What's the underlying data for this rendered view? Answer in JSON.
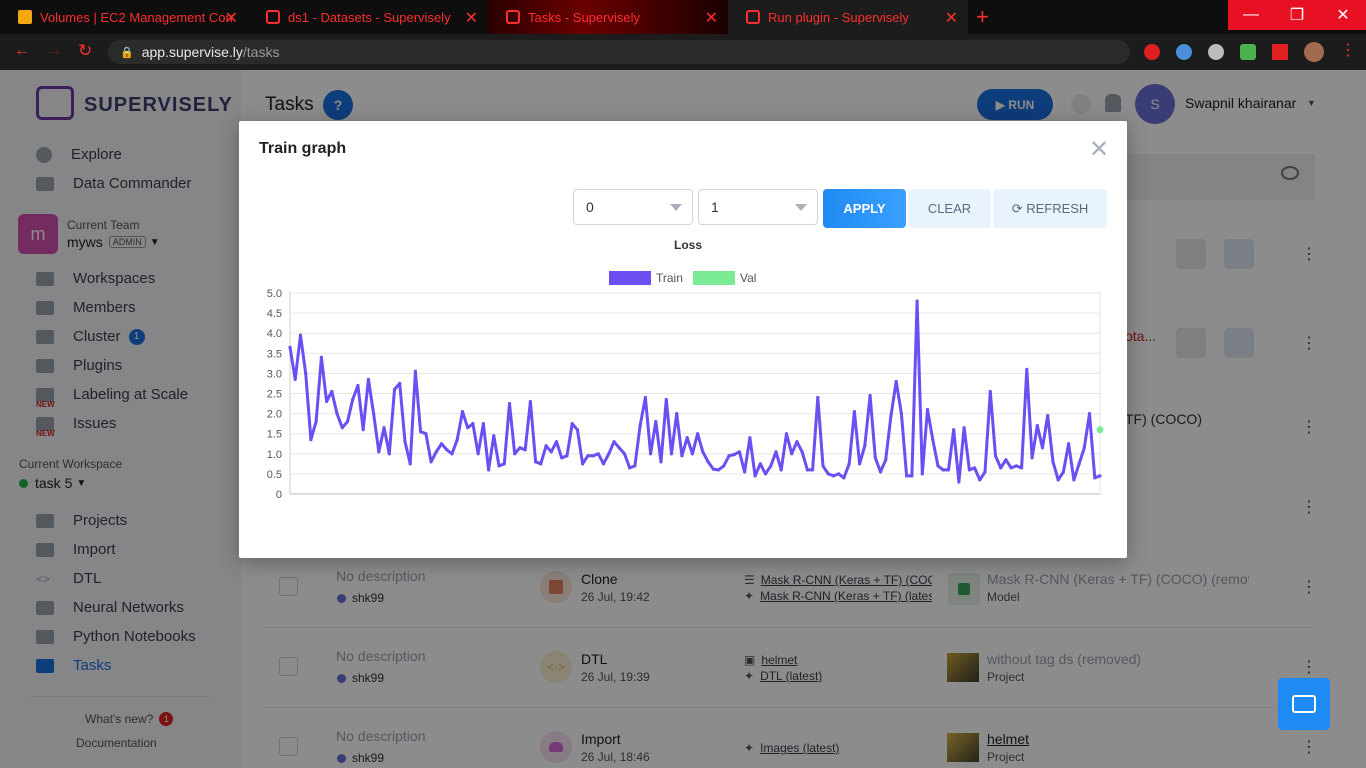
{
  "browser": {
    "tabs": [
      {
        "title": "Volumes | EC2 Management Con",
        "close": "✕"
      },
      {
        "title": "ds1 - Datasets - Supervisely",
        "close": "✕"
      },
      {
        "title": "Tasks - Supervisely",
        "close": "✕"
      },
      {
        "title": "Run plugin - Supervisely",
        "close": "✕"
      }
    ],
    "new_tab": "+",
    "url_domain": "app.supervise.ly",
    "url_path": "/tasks"
  },
  "sidebar": {
    "logo": "SUPERVISELY",
    "top_items": [
      {
        "label": "Explore"
      },
      {
        "label": "Data Commander"
      }
    ],
    "team": {
      "caption": "Current Team",
      "avatar": "m",
      "name": "myws",
      "role": "ADMIN"
    },
    "team_items": [
      {
        "label": "Workspaces"
      },
      {
        "label": "Members"
      },
      {
        "label": "Cluster",
        "badge": "1"
      },
      {
        "label": "Plugins"
      },
      {
        "label": "Labeling at Scale",
        "tag": "NEW"
      },
      {
        "label": "Issues",
        "tag": "NEW"
      }
    ],
    "workspace": {
      "caption": "Current Workspace",
      "name": "task 5"
    },
    "ws_items": [
      {
        "label": "Projects"
      },
      {
        "label": "Import"
      },
      {
        "label": "DTL"
      },
      {
        "label": "Neural Networks"
      },
      {
        "label": "Python Notebooks"
      },
      {
        "label": "Tasks"
      }
    ],
    "whats_new": "What's new?",
    "whats_new_badge": "1",
    "documentation": "Documentation"
  },
  "header": {
    "title": "Tasks",
    "help": "?",
    "run": "▶ RUN",
    "user_initial": "S",
    "user_name": "Swapnil khairanar"
  },
  "behind": {
    "row2_snippet": "ota...",
    "row3_snippet": "TF) (COCO)"
  },
  "rows": [
    {
      "desc": "No description",
      "user": "shk99",
      "type": "Clone",
      "date": "26 Jul, 19:42",
      "inputs": [
        "Mask R-CNN (Keras + TF) (COCO",
        "Mask R-CNN (Keras + TF) (lates"
      ],
      "output": "Mask R-CNN (Keras + TF) (COCO) (remove",
      "output_kind": "Model",
      "color": "#e8845f"
    },
    {
      "desc": "No description",
      "user": "shk99",
      "type": "DTL",
      "date": "26 Jul, 19:39",
      "inputs": [
        "helmet",
        "DTL (latest)"
      ],
      "output": "without tag ds (removed)",
      "output_kind": "Project",
      "color": "#e5b04b"
    },
    {
      "desc": "No description",
      "user": "shk99",
      "type": "Import",
      "date": "26 Jul, 18:46",
      "inputs": [
        "Images (latest)"
      ],
      "output": "helmet",
      "output_kind": "Project",
      "color": "#d26bd3"
    }
  ],
  "modal": {
    "title": "Train graph",
    "close": "✕",
    "from_value": "0",
    "to_value": "1",
    "apply": "APPLY",
    "clear": "CLEAR",
    "refresh": "⟳ REFRESH"
  },
  "colors": {
    "train": "#6c4ef2",
    "val": "#7bea95",
    "accent": "#1a6fe0",
    "tab_text": "#ff2e2e"
  },
  "chart_data": {
    "type": "line",
    "title": "Loss",
    "ylim": [
      0,
      5
    ],
    "yticks": [
      "0",
      "0.5",
      "1.0",
      "1.5",
      "2.0",
      "2.5",
      "3.0",
      "3.5",
      "4.0",
      "4.5",
      "5.0"
    ],
    "legend_position": "top",
    "grid": true,
    "series": [
      {
        "name": "Train",
        "values": [
          3.65,
          2.85,
          3.95,
          3.0,
          1.35,
          1.8,
          3.4,
          2.3,
          2.55,
          2.0,
          1.65,
          1.8,
          2.35,
          2.7,
          1.6,
          2.85,
          2.0,
          1.05,
          1.65,
          1.0,
          2.6,
          2.75,
          1.3,
          0.75,
          3.05,
          1.55,
          1.5,
          0.8,
          1.05,
          1.25,
          1.1,
          1.0,
          1.35,
          2.05,
          1.65,
          1.75,
          1.0,
          1.75,
          0.6,
          1.45,
          0.7,
          0.75,
          2.25,
          1.0,
          1.15,
          1.1,
          2.3,
          0.8,
          0.75,
          1.2,
          1.05,
          1.3,
          0.9,
          0.95,
          1.75,
          1.6,
          0.75,
          0.95,
          0.95,
          1.0,
          0.75,
          1.0,
          1.3,
          1.15,
          1.0,
          0.65,
          0.7,
          1.7,
          2.4,
          1.0,
          1.8,
          0.8,
          2.35,
          1.0,
          2.0,
          0.95,
          1.4,
          1.0,
          1.5,
          1.05,
          0.8,
          0.62,
          0.6,
          0.7,
          0.95,
          0.98,
          1.05,
          0.55,
          1.4,
          0.45,
          0.75,
          0.5,
          0.7,
          1.05,
          0.6,
          1.5,
          1.0,
          1.3,
          1.05,
          0.6,
          0.6,
          2.4,
          0.7,
          0.5,
          0.45,
          0.5,
          0.4,
          0.75,
          2.05,
          0.75,
          1.2,
          2.45,
          0.9,
          0.55,
          0.85,
          1.95,
          2.8,
          2.0,
          0.45,
          0.45,
          4.8,
          0.5,
          2.1,
          1.35,
          0.7,
          0.6,
          0.6,
          1.6,
          0.3,
          1.65,
          0.6,
          0.65,
          0.35,
          0.55,
          2.55,
          0.95,
          0.65,
          0.85,
          0.65,
          0.7,
          0.65,
          3.1,
          0.9,
          1.7,
          1.15,
          1.95,
          0.8,
          0.35,
          0.55,
          1.25,
          0.35,
          0.75,
          1.15,
          2.0,
          0.4,
          0.45
        ]
      },
      {
        "name": "Val",
        "values": [
          1.6
        ]
      }
    ]
  },
  "chat_icon": "chat"
}
